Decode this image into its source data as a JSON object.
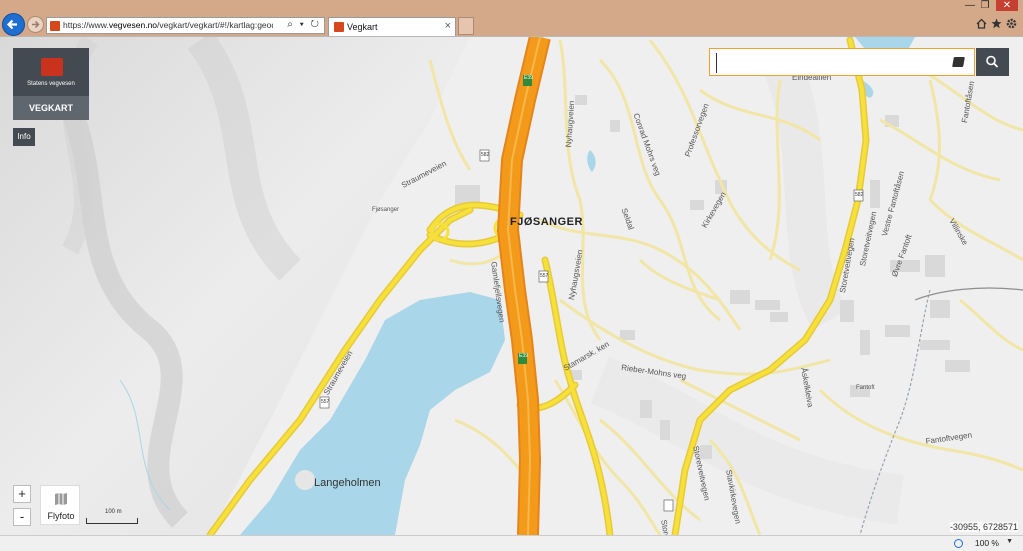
{
  "browser": {
    "url_prefix": "https://www.",
    "url_domain": "vegvesen.no",
    "url_rest": "/vegkart/vegkart/#!/kartlag:geodata/sok:%",
    "address_tools": "⌕ ▾ ↻",
    "tab_title": "Vegkart",
    "tab_close": "×",
    "win_minimize": "—",
    "win_restore": "❐",
    "win_close": "✕",
    "zoom_level": "100 %",
    "zoom_chevron": "▼"
  },
  "app": {
    "org_name": "Statens vegvesen",
    "app_title": "VEGKART",
    "info_label": "Info",
    "search": {
      "value": "",
      "placeholder": ""
    },
    "zoom_in": "+",
    "zoom_out": "-",
    "flyfoto_label": "Flyfoto",
    "scale_label": "100 m",
    "coordinates": "-30955, 6728571"
  },
  "map_labels": {
    "fjosanger": "FJØSANGER",
    "langeholmen": "Langeholmen",
    "straumeveien": "Straumeveien",
    "fjosanger_small": "Fjøsanger",
    "nyhaugveien": "Nyhaugveien",
    "conrad_mohrs": "Conrad Mohrs veg",
    "professorvegen": "Professorvegen",
    "kirkevegen": "Kirkevegen",
    "solheimsviken": "Seldal",
    "gamlefjell": "Gamlefjellsvegen",
    "stamaraskiften": "Stamarsk. ken",
    "rieber": "Rieber-Mohns veg",
    "storetveitvegen": "Storetveitvegen",
    "storetveitvegen2": "Storetveitvegen",
    "vestre_fantoft": "Vestre Fantoftåsen",
    "ovre_fantoft": "Øvre Fantoft",
    "fantoftvegen": "Fantoftvegen",
    "storetveitvegen3": "Storetveitvegen",
    "nyhaug2": "Nyhaugsveien",
    "askekleiva": "Åskelkleiva",
    "fantoftasen": "Fantoftåsen",
    "stavkirkevegen": "Stavkirkevegen",
    "fantoft": "Fantoft",
    "villinske": "Villinske",
    "straumeveien2": "Straumeveien",
    "storetveitveien_bottom": "Storetveitveien",
    "e39_a": "E39",
    "e39_b": "E39",
    "road_582": "582",
    "road_557": "557",
    "road_557b": "557",
    "road_582b": "582",
    "langeveien": "Eindeallien"
  },
  "colors": {
    "motorway": "#f39a1a",
    "motorway_core": "#f7b84a",
    "main_road": "#f5e13a",
    "water": "#a9d6e8",
    "brand_dark": "#444a52",
    "search_border": "#f0a12a"
  }
}
